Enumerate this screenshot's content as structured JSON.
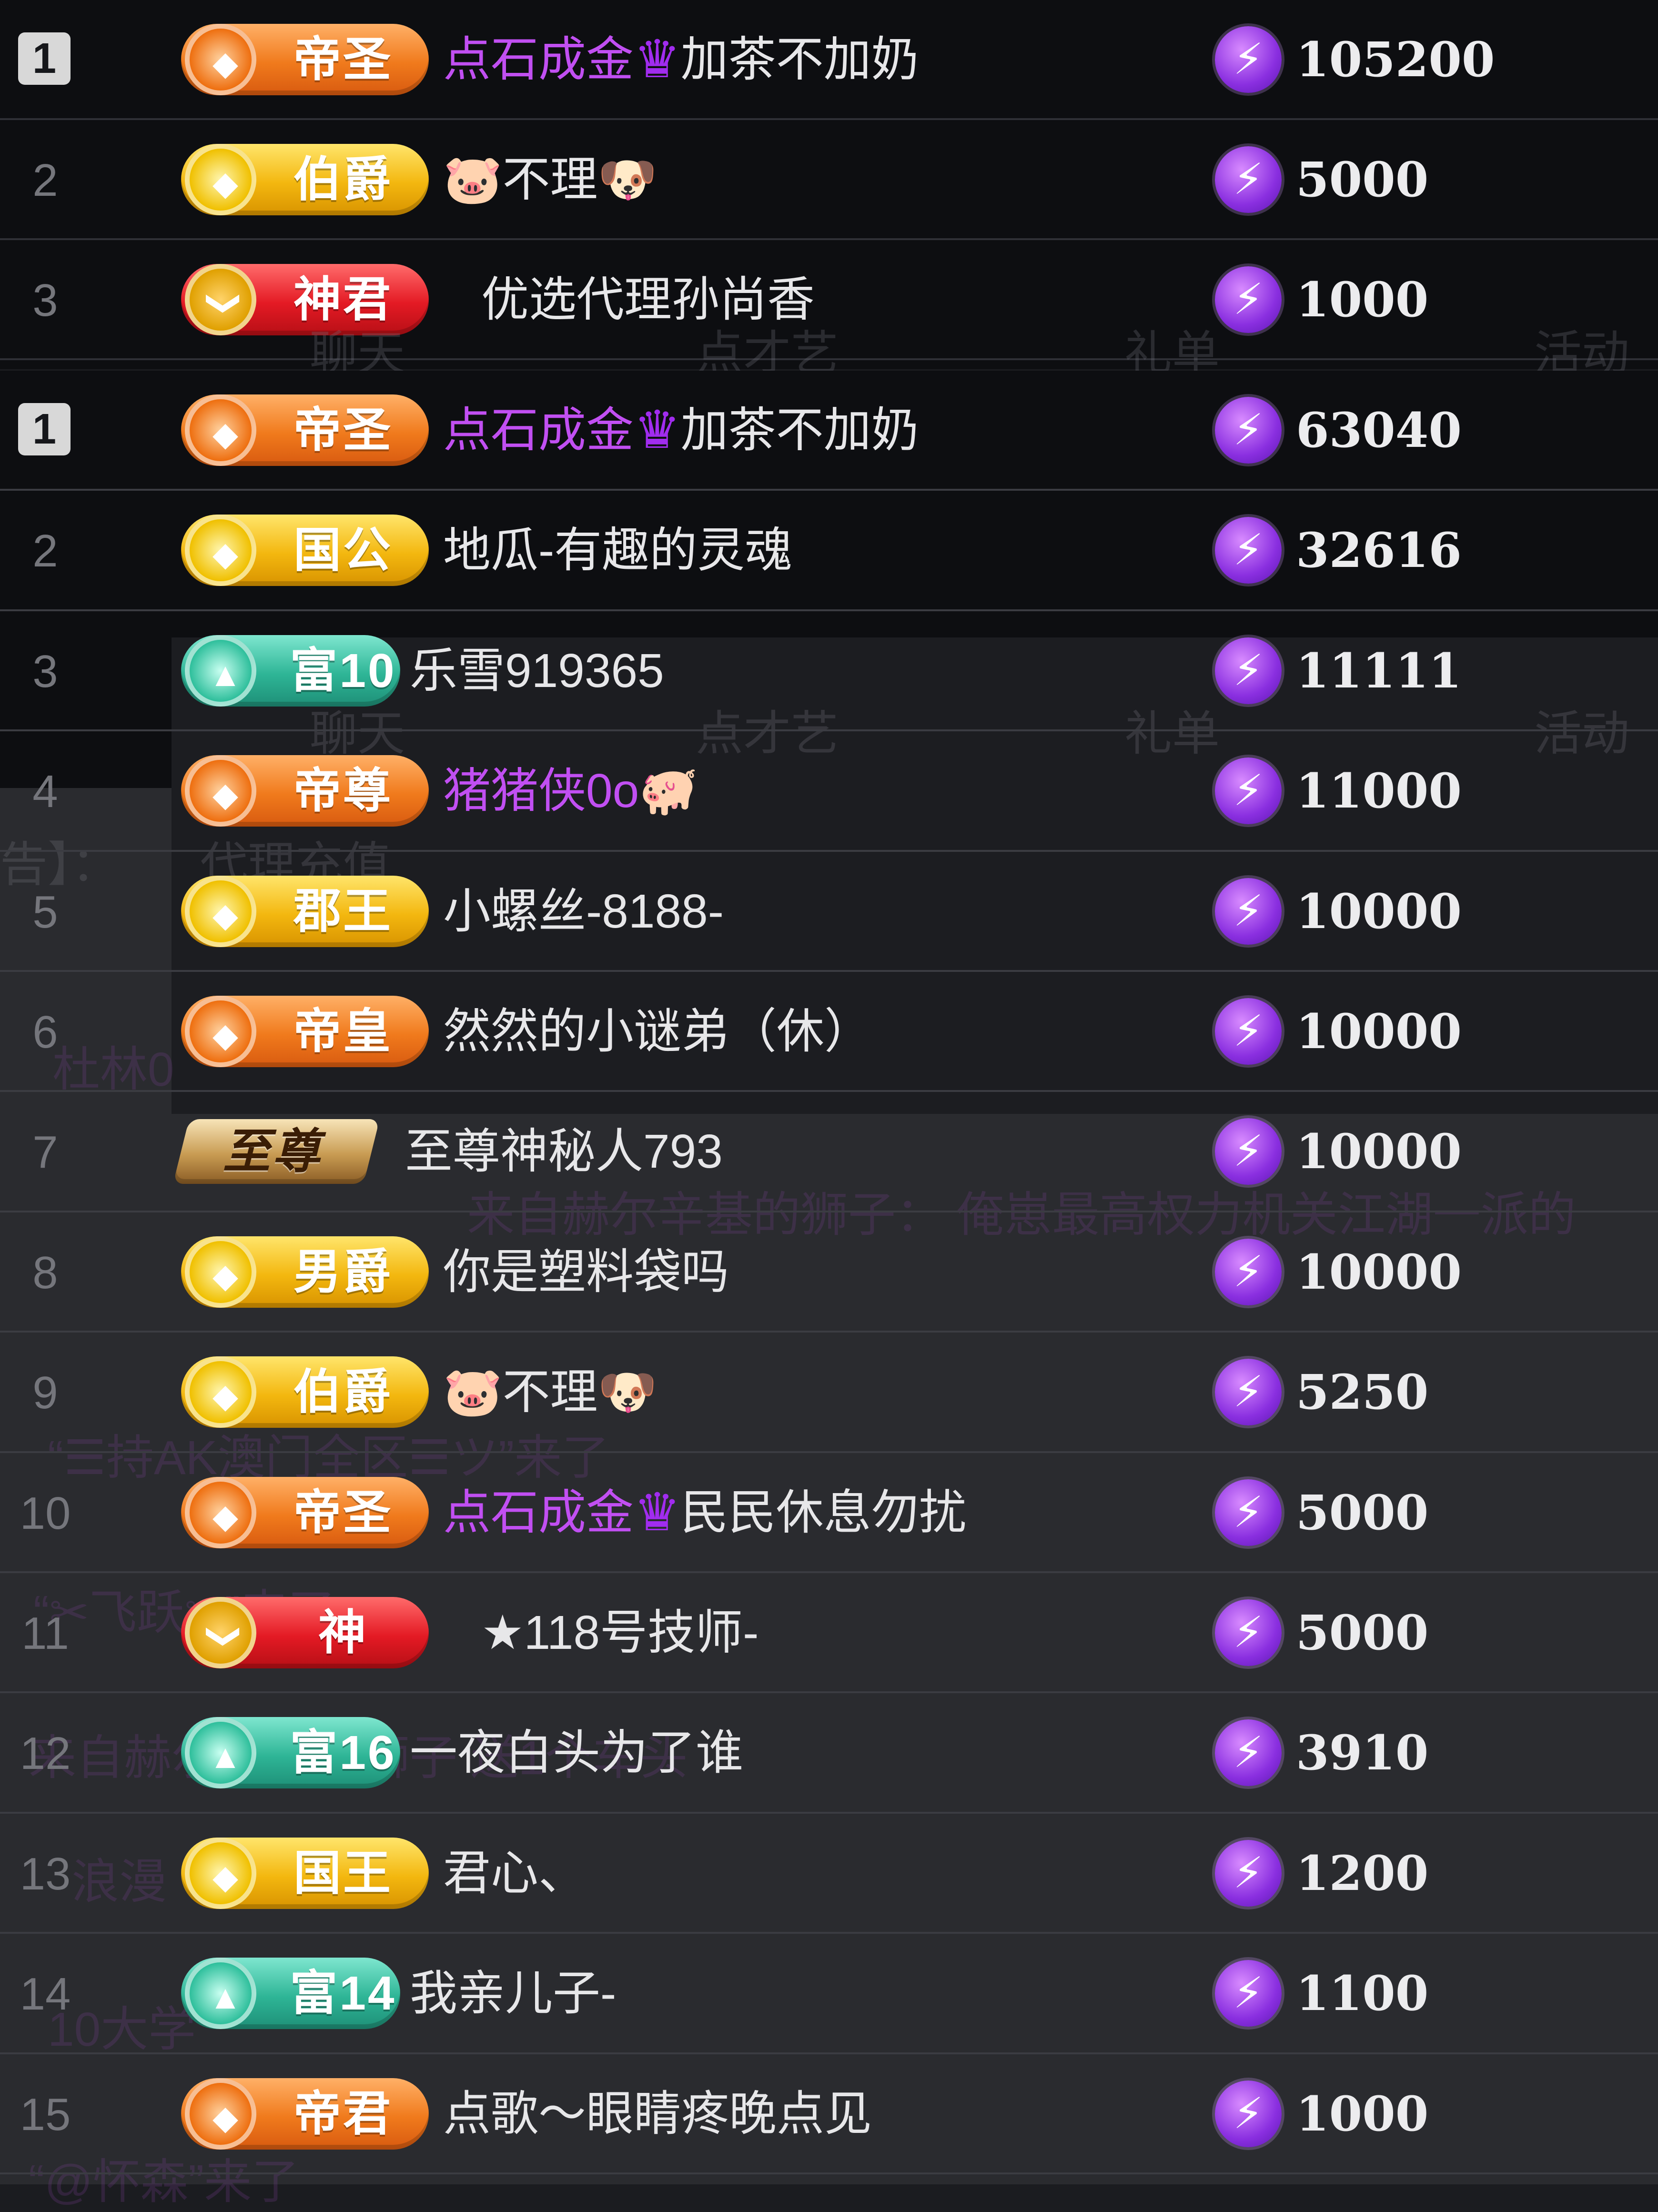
{
  "currency_icon": "lightning-bolt-coin-icon",
  "top_list": [
    {
      "rank": "1",
      "badge": "帝圣",
      "badge_style": "orange",
      "name_prefix": "点石成金",
      "crown": "♛",
      "name": "加茶不加奶",
      "score": "105200"
    },
    {
      "rank": "2",
      "badge": "伯爵",
      "badge_style": "gold",
      "name_prefix": "",
      "crown": "",
      "name": "🐷不理🐶",
      "score": "5000"
    },
    {
      "rank": "3",
      "badge": "神君",
      "badge_style": "red",
      "name_prefix": "",
      "crown": "",
      "name": "优选代理孙尚香",
      "score": "1000"
    }
  ],
  "main_list": [
    {
      "rank": "1",
      "badge": "帝圣",
      "badge_style": "orange",
      "name_prefix": "点石成金",
      "crown": "♛",
      "name": "加茶不加奶",
      "score": "63040"
    },
    {
      "rank": "2",
      "badge": "国公",
      "badge_style": "gold",
      "name_prefix": "",
      "crown": "",
      "name": "地瓜-有趣的灵魂",
      "score": "32616"
    },
    {
      "rank": "3",
      "badge": "富10",
      "badge_style": "teal",
      "name_prefix": "",
      "crown": "",
      "name": "乐雪919365",
      "score": "11111"
    },
    {
      "rank": "4",
      "badge": "帝尊",
      "badge_style": "orange",
      "name_prefix": "猪猪侠0o",
      "crown": "",
      "name": "🐖",
      "score": "11000"
    },
    {
      "rank": "5",
      "badge": "郡王",
      "badge_style": "gold",
      "name_prefix": "",
      "crown": "",
      "name": "小螺丝-8188-",
      "score": "10000"
    },
    {
      "rank": "6",
      "badge": "帝皇",
      "badge_style": "orange",
      "name_prefix": "",
      "crown": "",
      "name": "然然的小谜弟（休）",
      "score": "10000"
    },
    {
      "rank": "7",
      "badge": "至尊",
      "badge_style": "zz",
      "name_prefix": "",
      "crown": "",
      "name": "至尊神秘人793",
      "score": "10000"
    },
    {
      "rank": "8",
      "badge": "男爵",
      "badge_style": "gold",
      "name_prefix": "",
      "crown": "",
      "name": "你是塑料袋吗",
      "score": "10000"
    },
    {
      "rank": "9",
      "badge": "伯爵",
      "badge_style": "gold",
      "name_prefix": "",
      "crown": "",
      "name": "🐷不理🐶",
      "score": "5250"
    },
    {
      "rank": "10",
      "badge": "帝圣",
      "badge_style": "orange",
      "name_prefix": "点石成金",
      "crown": "♛",
      "name": "民民休息勿扰",
      "score": "5000"
    },
    {
      "rank": "11",
      "badge": "神",
      "badge_style": "red",
      "name_prefix": "",
      "crown": "",
      "name": "★118号技师-",
      "score": "5000"
    },
    {
      "rank": "12",
      "badge": "富16",
      "badge_style": "teal",
      "name_prefix": "",
      "crown": "",
      "name": "一夜白头为了谁",
      "score": "3910"
    },
    {
      "rank": "13",
      "badge": "国王",
      "badge_style": "gold",
      "name_prefix": "",
      "crown": "",
      "name": "君心、",
      "score": "1200"
    },
    {
      "rank": "14",
      "badge": "富14",
      "badge_style": "teal",
      "name_prefix": "",
      "crown": "",
      "name": "我亲儿子-",
      "score": "1100"
    },
    {
      "rank": "15",
      "badge": "帝君",
      "badge_style": "orange",
      "name_prefix": "",
      "crown": "",
      "name": "点歌～眼睛疼晚点见",
      "score": "1000"
    }
  ],
  "background_overlay": {
    "tabs": [
      "聊天",
      "点才艺",
      "礼单",
      "活动"
    ],
    "notice_label": "告】：",
    "notice_button": "代理充值",
    "chat_lines": [
      "杜林0",
      "来自赫尔辛基的狮子： 俺崽最高权力机关江湖一派的",
      "“☰持AK澳门全区☰ツ”来了",
      "“✂飞跃✂”来了",
      "来自赫尔辛基的狮子 送1个车头",
      "浪漫",
      "10大学",
      "“@怀森”来了"
    ]
  }
}
